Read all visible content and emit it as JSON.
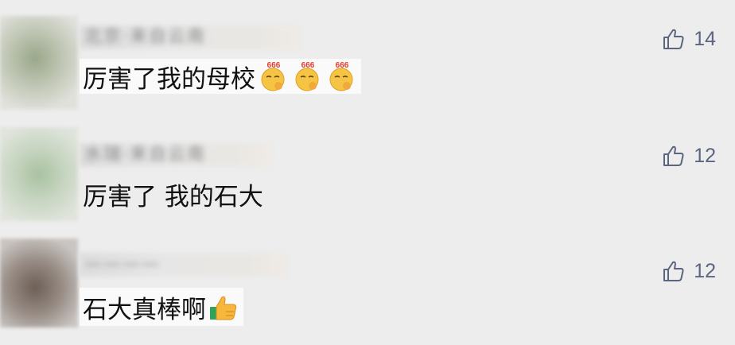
{
  "comments": [
    {
      "author": "北京·来自云南",
      "text": "厉害了我的母校",
      "emojis": [
        "666-emoji",
        "666-emoji",
        "666-emoji"
      ],
      "emoji_label": "666",
      "likes": "14"
    },
    {
      "author": "水瑞·来自云南",
      "text": "厉害了 我的石大",
      "emojis": [],
      "likes": "12"
    },
    {
      "author": "————",
      "text": "石大真棒啊",
      "emojis": [
        "thumbs-up-emoji"
      ],
      "likes": "12"
    }
  ],
  "colors": {
    "background": "#ededed",
    "like_icon": "#5b6580",
    "text": "#111111"
  }
}
